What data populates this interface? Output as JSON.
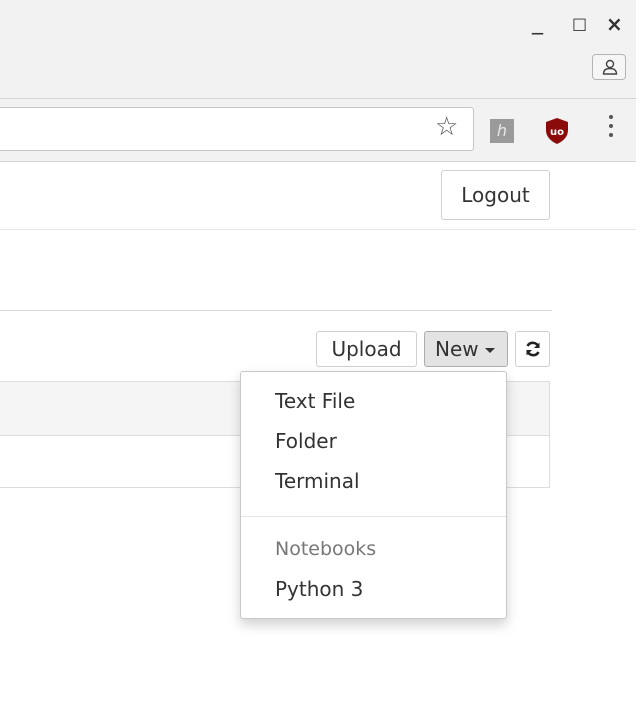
{
  "window": {
    "minimize_glyph": "_",
    "maximize_glyph": "□",
    "close_glyph": "×"
  },
  "browser": {
    "star_icon": "star-icon",
    "extensions": [
      "h-extension-icon",
      "ublock-origin-icon"
    ]
  },
  "header": {
    "logout_label": "Logout"
  },
  "file_toolbar": {
    "upload_label": "Upload",
    "new_label": "New",
    "refresh_icon": "refresh-icon"
  },
  "new_menu": {
    "items": [
      "Text File",
      "Folder",
      "Terminal"
    ],
    "section_header": "Notebooks",
    "kernels": [
      "Python 3"
    ]
  },
  "colors": {
    "ublock_red": "#8b0b0b",
    "new_button_bg": "#e3e3e3"
  }
}
